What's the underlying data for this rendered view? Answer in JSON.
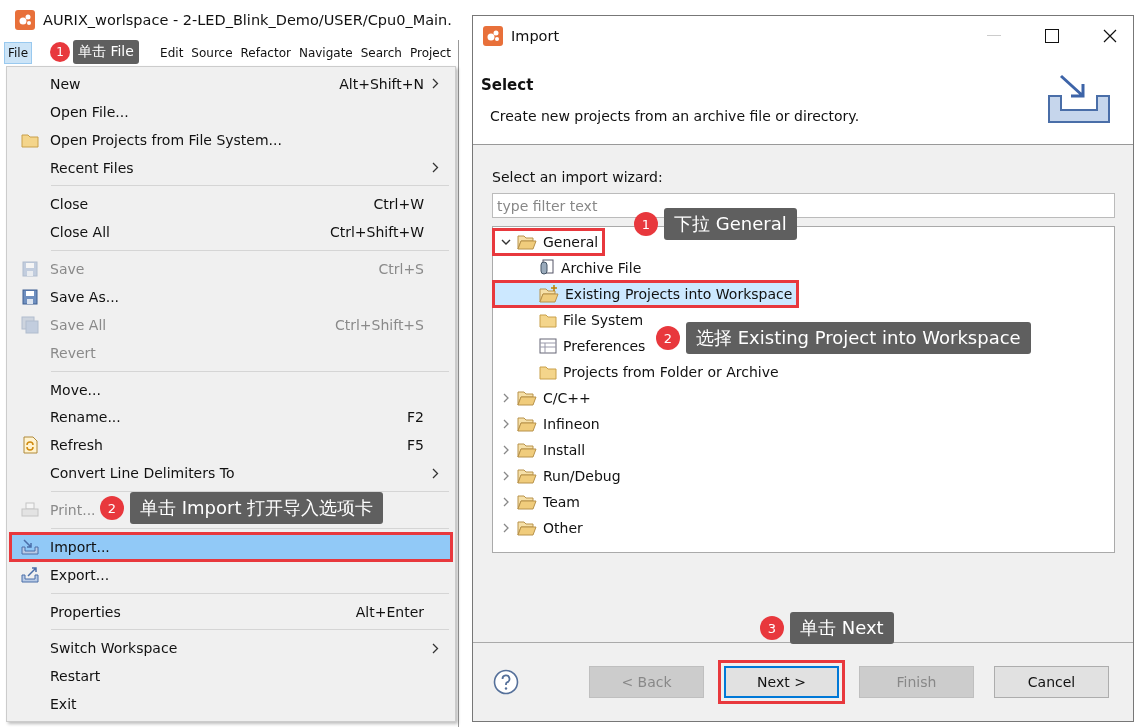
{
  "ide": {
    "title": "AURIX_worlspace - 2-LED_Blink_Demo/USER/Cpu0_Main.",
    "menubar": [
      {
        "label": "File",
        "selected": true
      },
      {
        "label": "Edit",
        "selected": false
      },
      {
        "label": "Source",
        "selected": false
      },
      {
        "label": "Refactor",
        "selected": false
      },
      {
        "label": "Navigate",
        "selected": false
      },
      {
        "label": "Search",
        "selected": false
      },
      {
        "label": "Project",
        "selected": false
      }
    ],
    "file_menu": [
      {
        "kind": "item",
        "label": "New",
        "shortcut": "Alt+Shift+N",
        "submenu": true,
        "disabled": false,
        "selected": false,
        "highlighted": false
      },
      {
        "kind": "item",
        "label": "Open File...",
        "submenu": false,
        "disabled": false,
        "selected": false,
        "highlighted": false
      },
      {
        "kind": "item",
        "label": "Open Projects from File System...",
        "submenu": false,
        "disabled": false,
        "selected": false,
        "highlighted": false
      },
      {
        "kind": "item",
        "label": "Recent Files",
        "submenu": true,
        "disabled": false,
        "selected": false,
        "highlighted": false
      },
      {
        "kind": "separator"
      },
      {
        "kind": "item",
        "label": "Close",
        "shortcut": "Ctrl+W",
        "submenu": false,
        "disabled": false,
        "selected": false,
        "highlighted": false
      },
      {
        "kind": "item",
        "label": "Close All",
        "shortcut": "Ctrl+Shift+W",
        "submenu": false,
        "disabled": false,
        "selected": false,
        "highlighted": false
      },
      {
        "kind": "separator"
      },
      {
        "kind": "item",
        "label": "Save",
        "shortcut": "Ctrl+S",
        "submenu": false,
        "disabled": true,
        "selected": false,
        "highlighted": false
      },
      {
        "kind": "item",
        "label": "Save As...",
        "submenu": false,
        "disabled": false,
        "selected": false,
        "highlighted": false
      },
      {
        "kind": "item",
        "label": "Save All",
        "shortcut": "Ctrl+Shift+S",
        "submenu": false,
        "disabled": true,
        "selected": false,
        "highlighted": false
      },
      {
        "kind": "item",
        "label": "Revert",
        "submenu": false,
        "disabled": true,
        "selected": false,
        "highlighted": false
      },
      {
        "kind": "separator"
      },
      {
        "kind": "item",
        "label": "Move...",
        "submenu": false,
        "disabled": false,
        "selected": false,
        "highlighted": false
      },
      {
        "kind": "item",
        "label": "Rename...",
        "shortcut": "F2",
        "submenu": false,
        "disabled": false,
        "selected": false,
        "highlighted": false
      },
      {
        "kind": "item",
        "label": "Refresh",
        "shortcut": "F5",
        "submenu": false,
        "disabled": false,
        "selected": false,
        "highlighted": false
      },
      {
        "kind": "item",
        "label": "Convert Line Delimiters To",
        "submenu": true,
        "disabled": false,
        "selected": false,
        "highlighted": false
      },
      {
        "kind": "separator"
      },
      {
        "kind": "item",
        "label": "Print...",
        "submenu": false,
        "disabled": true,
        "selected": false,
        "highlighted": false
      },
      {
        "kind": "separator"
      },
      {
        "kind": "item",
        "label": "Import...",
        "submenu": false,
        "disabled": false,
        "selected": true,
        "highlighted": true
      },
      {
        "kind": "item",
        "label": "Export...",
        "submenu": false,
        "disabled": false,
        "selected": false,
        "highlighted": false
      },
      {
        "kind": "separator"
      },
      {
        "kind": "item",
        "label": "Properties",
        "shortcut": "Alt+Enter",
        "submenu": false,
        "disabled": false,
        "selected": false,
        "highlighted": false
      },
      {
        "kind": "separator"
      },
      {
        "kind": "item",
        "label": "Switch Workspace",
        "submenu": true,
        "disabled": false,
        "selected": false,
        "highlighted": false
      },
      {
        "kind": "item",
        "label": "Restart",
        "submenu": false,
        "disabled": false,
        "selected": false,
        "highlighted": false
      },
      {
        "kind": "item",
        "label": "Exit",
        "submenu": false,
        "disabled": false,
        "selected": false,
        "highlighted": false
      }
    ]
  },
  "dialog": {
    "title": "Import",
    "heading": "Select",
    "description": "Create new projects from an archive file or directory.",
    "wizard_label": "Select an import wizard:",
    "filter": {
      "placeholder": "type filter text"
    },
    "tree": [
      {
        "label": "General",
        "expanded": true,
        "selected": false,
        "highlighted": true,
        "children": [
          {
            "label": "Archive File",
            "selected": false,
            "highlighted": false
          },
          {
            "label": "Existing Projects into Workspace",
            "selected": true,
            "highlighted": true
          },
          {
            "label": "File System",
            "selected": false,
            "highlighted": false
          },
          {
            "label": "Preferences",
            "selected": false,
            "highlighted": false
          },
          {
            "label": "Projects from Folder or Archive",
            "selected": false,
            "highlighted": false
          }
        ]
      },
      {
        "label": "C/C++",
        "expanded": false,
        "selected": false,
        "highlighted": false
      },
      {
        "label": "Infineon",
        "expanded": false,
        "selected": false,
        "highlighted": false
      },
      {
        "label": "Install",
        "expanded": false,
        "selected": false,
        "highlighted": false
      },
      {
        "label": "Run/Debug",
        "expanded": false,
        "selected": false,
        "highlighted": false
      },
      {
        "label": "Team",
        "expanded": false,
        "selected": false,
        "highlighted": false
      },
      {
        "label": "Other",
        "expanded": false,
        "selected": false,
        "highlighted": false
      }
    ],
    "buttons": [
      {
        "label": "< Back",
        "disabled": true,
        "default": false,
        "highlighted": false
      },
      {
        "label": "Next >",
        "disabled": false,
        "default": true,
        "highlighted": true
      },
      {
        "label": "Finish",
        "disabled": true,
        "default": false,
        "highlighted": false
      },
      {
        "label": "Cancel",
        "disabled": false,
        "default": false,
        "highlighted": false
      }
    ]
  },
  "callouts": [
    {
      "number": "1",
      "text": "单击 File"
    },
    {
      "number": "2",
      "text": "单击 Import 打开导入选项卡"
    },
    {
      "number": "1",
      "text": "下拉 General"
    },
    {
      "number": "2",
      "text": "选择 Existing Project into Workspace"
    },
    {
      "number": "3",
      "text": "单击 Next"
    }
  ]
}
